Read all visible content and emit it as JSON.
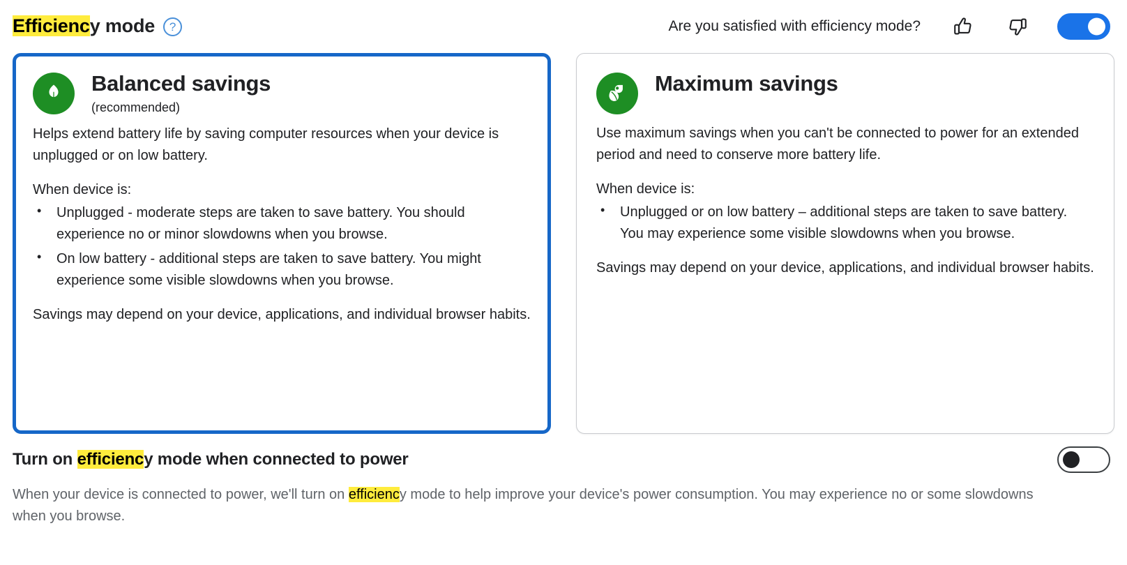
{
  "header": {
    "title_highlighted": "Efficienc",
    "title_rest": "y mode",
    "help_icon_label": "?",
    "satisfaction_question": "Are you satisfied with efficiency mode?",
    "thumbs_up_icon": "thumbs-up-icon",
    "thumbs_down_icon": "thumbs-down-icon",
    "efficiency_mode_toggle_state": "on"
  },
  "cards": [
    {
      "id": "balanced-savings",
      "selected": true,
      "icon": "single-leaf-icon",
      "title": "Balanced savings",
      "subtitle": "(recommended)",
      "intro": "Helps extend battery life by saving computer resources when your device is unplugged or on low battery.",
      "condition_label": "When device is:",
      "bullets": [
        "Unplugged - moderate steps are taken to save battery. You should experience no or minor slowdowns when you browse.",
        "On low battery - additional steps are taken to save battery. You might experience some visible slowdowns when you browse."
      ],
      "footnote": "Savings may depend on your device, applications, and individual browser habits."
    },
    {
      "id": "maximum-savings",
      "selected": false,
      "icon": "double-leaf-icon",
      "title": "Maximum savings",
      "subtitle": "",
      "intro": "Use maximum savings when you can't be connected to power for an extended period and need to conserve more battery life.",
      "condition_label": "When device is:",
      "bullets": [
        "Unplugged or on low battery – additional steps are taken to save battery. You may experience some visible slowdowns when you browse."
      ],
      "footnote": "Savings may depend on your device, applications, and individual browser habits."
    }
  ],
  "bottom": {
    "title_pre": "Turn on ",
    "title_highlighted": "efficienc",
    "title_post": "y mode when connected to power",
    "description_pre": "When your device is connected to power, we'll turn on ",
    "description_highlighted": "efficienc",
    "description_post": "y mode to help improve your device's power consumption. You may experience no or some slowdowns when you browse.",
    "connected_toggle_state": "off"
  },
  "colors": {
    "accent_blue": "#1a73e8",
    "selected_border_blue": "#1667c8",
    "leaf_green": "#1e8e24",
    "highlight_yellow": "#ffec3d",
    "help_icon_blue": "#4a90d9",
    "muted_text": "#5f6368",
    "card_border_gray": "#c9cbcf"
  }
}
